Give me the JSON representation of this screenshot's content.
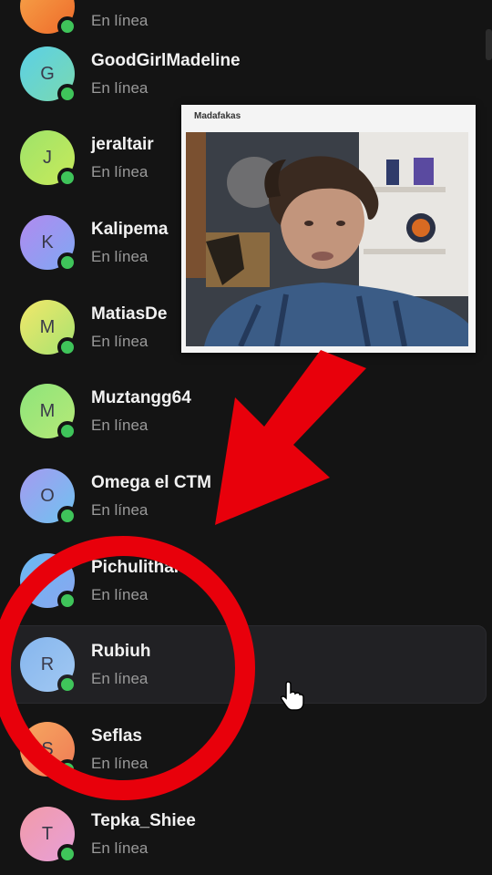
{
  "members": [
    {
      "initial": "",
      "name": "",
      "status": "En línea",
      "color_a": "#f7a64a",
      "color_b": "#ee6a2a"
    },
    {
      "initial": "G",
      "name": "GoodGirlMadeline",
      "status": "En línea",
      "color_a": "#5bd0e6",
      "color_b": "#7ad9b0"
    },
    {
      "initial": "J",
      "name": "jeraltair",
      "status": "En línea",
      "color_a": "#9ee36a",
      "color_b": "#c8ea5a"
    },
    {
      "initial": "K",
      "name": "Kalipema",
      "status": "En línea",
      "color_a": "#b18af0",
      "color_b": "#7fa8f2"
    },
    {
      "initial": "M",
      "name": "MatiasDe",
      "status": "En línea",
      "color_a": "#f2e86a",
      "color_b": "#a8e270"
    },
    {
      "initial": "M",
      "name": "Muztangg64",
      "status": "En línea",
      "color_a": "#8ee47a",
      "color_b": "#b6e978"
    },
    {
      "initial": "O",
      "name": "Omega el CTM",
      "status": "En línea",
      "color_a": "#a59af0",
      "color_b": "#6fc3f0"
    },
    {
      "initial": "P",
      "name": "Pichulithan",
      "status": "En línea",
      "color_a": "#6ab9f2",
      "color_b": "#8aa6f0"
    },
    {
      "initial": "R",
      "name": "Rubiuh",
      "status": "En línea",
      "color_a": "#86b6ee",
      "color_b": "#a1c8f2"
    },
    {
      "initial": "S",
      "name": "Seflas",
      "status": "En línea",
      "color_a": "#f7a860",
      "color_b": "#ef7b55"
    },
    {
      "initial": "T",
      "name": "Tepka_Shiee",
      "status": "En línea",
      "color_a": "#f29aa8",
      "color_b": "#e7a0d8"
    }
  ],
  "webcam": {
    "title": "Madafakas"
  },
  "colors": {
    "online": "#3fc45a",
    "annotation": "#e8000b",
    "hover_row": "#212124"
  },
  "icons": {
    "cursor": "hand-pointer-icon",
    "arrow": "red-arrow-annotation",
    "circle": "red-circle-annotation"
  }
}
